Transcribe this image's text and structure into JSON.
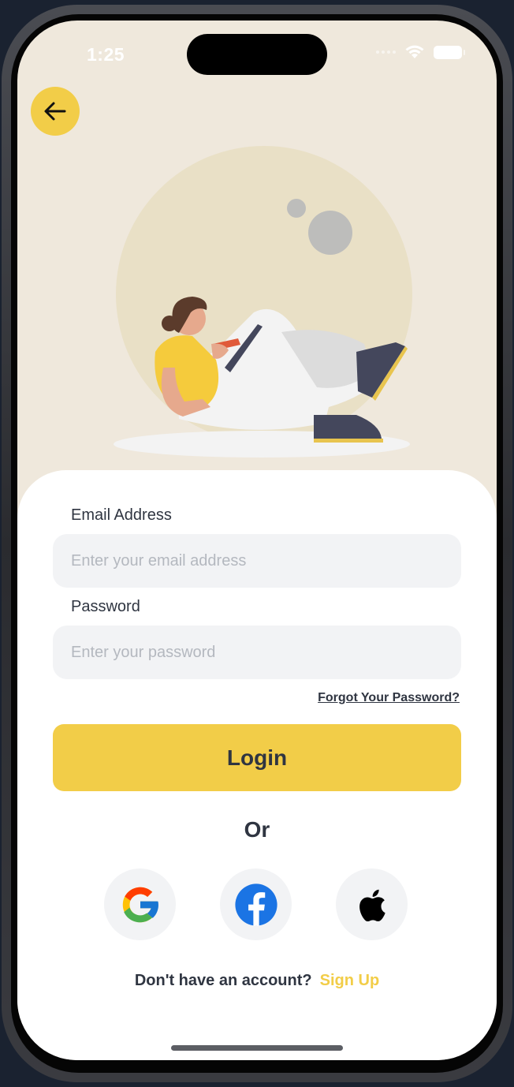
{
  "status_bar": {
    "time": "1:25"
  },
  "form": {
    "email_label": "Email Address",
    "email_placeholder": "Enter your email address",
    "password_label": "Password",
    "password_placeholder": "Enter your password",
    "forgot_password": "Forgot Your Password?",
    "login_label": "Login",
    "or_label": "Or"
  },
  "social": [
    {
      "name": "Google",
      "icon": "google-icon"
    },
    {
      "name": "Facebook",
      "icon": "facebook-icon"
    },
    {
      "name": "Apple",
      "icon": "apple-icon"
    }
  ],
  "footer": {
    "prompt": "Don't have an account?",
    "signup_label": "Sign Up"
  },
  "colors": {
    "accent": "#f2cd48",
    "background": "#efe8dc",
    "text": "#2f3541",
    "input_bg": "#f2f3f5"
  }
}
